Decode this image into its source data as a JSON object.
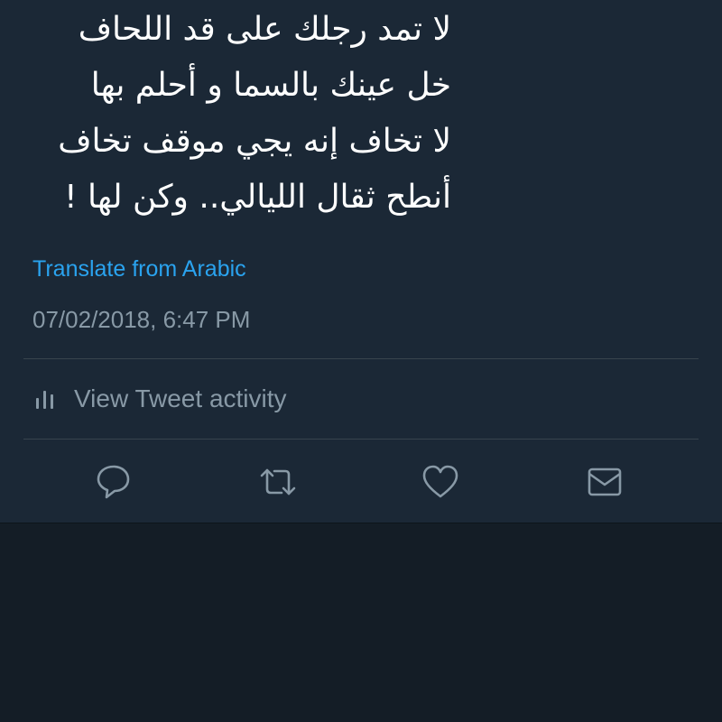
{
  "tweet": {
    "lines": [
      "لا تمد رجلك على قد اللحاف",
      "خل عينك بالسما و أحلم بها",
      "لا تخاف إنه يجي موقف تخاف",
      "أنطح ثقال الليالي.. وكن لها !"
    ],
    "translate_label": "Translate from Arabic",
    "timestamp": "07/02/2018, 6:47 PM"
  },
  "activity": {
    "label": "View Tweet activity",
    "icon": "bar-chart-icon"
  },
  "actions": [
    {
      "name": "reply",
      "icon": "reply-icon"
    },
    {
      "name": "retweet",
      "icon": "retweet-icon"
    },
    {
      "name": "like",
      "icon": "heart-icon"
    },
    {
      "name": "direct-message",
      "icon": "envelope-icon"
    }
  ],
  "colors": {
    "panel_bg": "#1b2836",
    "page_bg": "#141d26",
    "link": "#2aa3ef",
    "muted": "#8899a6",
    "divider": "#38444d",
    "text": "#ffffff"
  }
}
